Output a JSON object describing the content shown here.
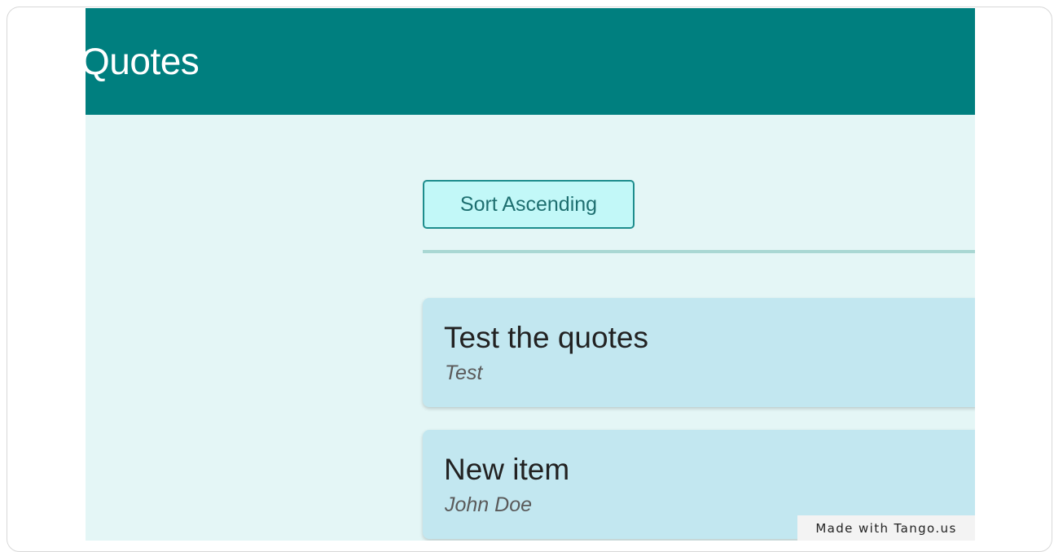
{
  "header": {
    "title": "Quotes"
  },
  "toolbar": {
    "sort_label": "Sort Ascending"
  },
  "quotes": [
    {
      "text": "Test the quotes",
      "author": "Test"
    },
    {
      "text": "New item",
      "author": "John Doe"
    }
  ],
  "watermark": {
    "label": "Made with Tango.us"
  },
  "colors": {
    "header_bg": "#007f7f",
    "page_bg": "#e4f6f6",
    "button_bg": "#c2f8f8",
    "card_bg": "#c2e7f0"
  }
}
